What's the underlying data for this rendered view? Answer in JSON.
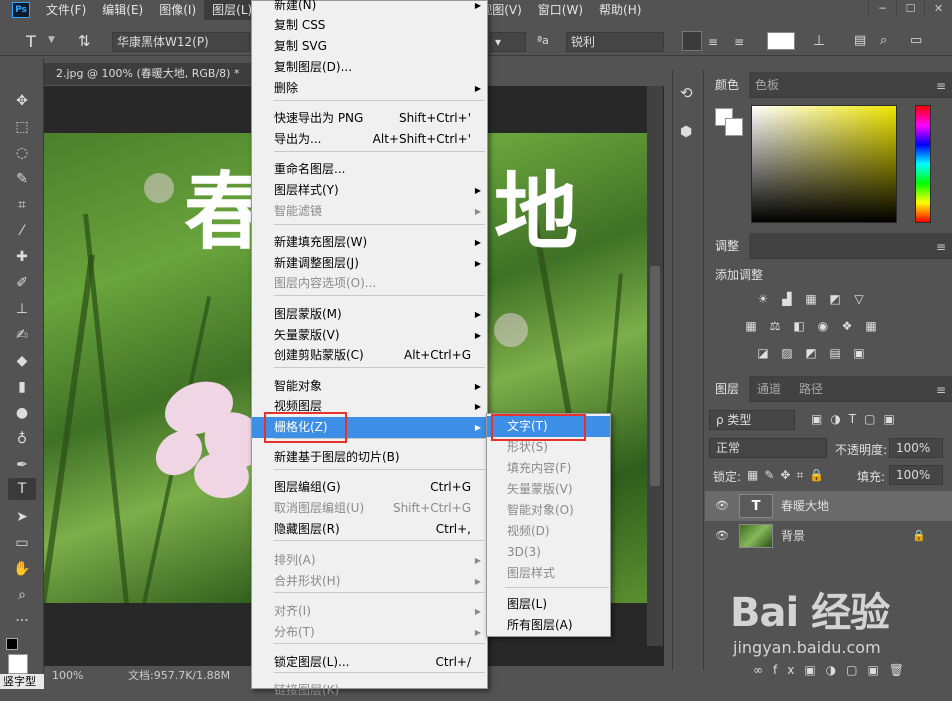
{
  "menubar": {
    "logo": "Ps",
    "items": [
      "文件(F)",
      "编辑(E)",
      "图像(I)",
      "图层(L)",
      "文字(Y)",
      "选择(S)",
      "滤镜(T)",
      "3D(D)",
      "视图(V)",
      "窗口(W)",
      "帮助(H)"
    ]
  },
  "options": {
    "tool_icon": "T",
    "font_family": "华康黑体W12(P)",
    "aa_label": "ªa",
    "aa_mode": "锐利"
  },
  "document": {
    "tab_label": "2.jpg @ 100% (春暖大地, RGB/8) *",
    "canvas_text": "春暖大地",
    "zoom": "100%",
    "doc_size": "文档:957.7K/1.88M"
  },
  "layer_menu": {
    "items": [
      {
        "label": "新建(N)",
        "shortcut": "",
        "submenu": true,
        "disabled": false
      },
      {
        "label": "复制 CSS",
        "shortcut": "",
        "submenu": false,
        "disabled": false
      },
      {
        "label": "复制 SVG",
        "shortcut": "",
        "submenu": false,
        "disabled": false
      },
      {
        "label": "复制图层(D)...",
        "shortcut": "",
        "submenu": false,
        "disabled": false
      },
      {
        "label": "删除",
        "shortcut": "",
        "submenu": true,
        "disabled": false
      },
      {
        "label": "快速导出为 PNG",
        "shortcut": "Shift+Ctrl+'",
        "submenu": false,
        "disabled": false
      },
      {
        "label": "导出为...",
        "shortcut": "Alt+Shift+Ctrl+'",
        "submenu": false,
        "disabled": false
      },
      {
        "label": "重命名图层...",
        "shortcut": "",
        "submenu": false,
        "disabled": false
      },
      {
        "label": "图层样式(Y)",
        "shortcut": "",
        "submenu": true,
        "disabled": false
      },
      {
        "label": "智能滤镜",
        "shortcut": "",
        "submenu": true,
        "disabled": true
      },
      {
        "label": "新建填充图层(W)",
        "shortcut": "",
        "submenu": true,
        "disabled": false
      },
      {
        "label": "新建调整图层(J)",
        "shortcut": "",
        "submenu": true,
        "disabled": false
      },
      {
        "label": "图层内容选项(O)...",
        "shortcut": "",
        "submenu": false,
        "disabled": true
      },
      {
        "label": "图层蒙版(M)",
        "shortcut": "",
        "submenu": true,
        "disabled": false
      },
      {
        "label": "矢量蒙版(V)",
        "shortcut": "",
        "submenu": true,
        "disabled": false
      },
      {
        "label": "创建剪贴蒙版(C)",
        "shortcut": "Alt+Ctrl+G",
        "submenu": false,
        "disabled": false
      },
      {
        "label": "智能对象",
        "shortcut": "",
        "submenu": true,
        "disabled": false
      },
      {
        "label": "视频图层",
        "shortcut": "",
        "submenu": true,
        "disabled": false
      },
      {
        "label": "栅格化(Z)",
        "shortcut": "",
        "submenu": true,
        "disabled": false,
        "highlighted": true
      },
      {
        "label": "新建基于图层的切片(B)",
        "shortcut": "",
        "submenu": false,
        "disabled": false
      },
      {
        "label": "图层编组(G)",
        "shortcut": "Ctrl+G",
        "submenu": false,
        "disabled": false
      },
      {
        "label": "取消图层编组(U)",
        "shortcut": "Shift+Ctrl+G",
        "submenu": false,
        "disabled": true
      },
      {
        "label": "隐藏图层(R)",
        "shortcut": "Ctrl+,",
        "submenu": false,
        "disabled": false
      },
      {
        "label": "排列(A)",
        "shortcut": "",
        "submenu": true,
        "disabled": true
      },
      {
        "label": "合并形状(H)",
        "shortcut": "",
        "submenu": true,
        "disabled": true
      },
      {
        "label": "对齐(I)",
        "shortcut": "",
        "submenu": true,
        "disabled": true
      },
      {
        "label": "分布(T)",
        "shortcut": "",
        "submenu": true,
        "disabled": true
      },
      {
        "label": "锁定图层(L)...",
        "shortcut": "Ctrl+/",
        "submenu": false,
        "disabled": false
      },
      {
        "label": "链接图层(K)",
        "shortcut": "",
        "submenu": false,
        "disabled": true
      }
    ]
  },
  "rasterize_submenu": {
    "items": [
      {
        "label": "文字(T)",
        "disabled": false,
        "highlighted": true
      },
      {
        "label": "形状(S)",
        "disabled": true
      },
      {
        "label": "填充内容(F)",
        "disabled": true
      },
      {
        "label": "矢量蒙版(V)",
        "disabled": true
      },
      {
        "label": "智能对象(O)",
        "disabled": true
      },
      {
        "label": "视频(D)",
        "disabled": true
      },
      {
        "label": "3D(3)",
        "disabled": true
      },
      {
        "label": "图层样式",
        "disabled": true
      },
      {
        "label": "图层(L)",
        "disabled": false
      },
      {
        "label": "所有图层(A)",
        "disabled": false
      }
    ]
  },
  "panels": {
    "color_tabs": [
      "颜色",
      "色板"
    ],
    "adjust_tab": "调整",
    "adjust_title": "添加调整",
    "layers_tabs": [
      "图层",
      "通道",
      "路径"
    ],
    "kind_label": "ρ 类型",
    "blend_mode": "正常",
    "opacity_label": "不透明度:",
    "opacity_value": "100%",
    "lock_label": "锁定:",
    "fill_label": "填充:",
    "fill_value": "100%",
    "layers": [
      {
        "name": "春暖大地",
        "type": "text",
        "selected": true
      },
      {
        "name": "背景",
        "type": "image",
        "locked": true
      }
    ]
  },
  "bottom_left": {
    "tool_hint": "竖字型"
  },
  "watermark": {
    "logo": "Bai  经验",
    "url": "jingyan.baidu.com"
  },
  "colors": {
    "menu_highlight": "#3d8ee6",
    "red_outline": "#e8312c",
    "ps_blue": "#31a8ff"
  }
}
